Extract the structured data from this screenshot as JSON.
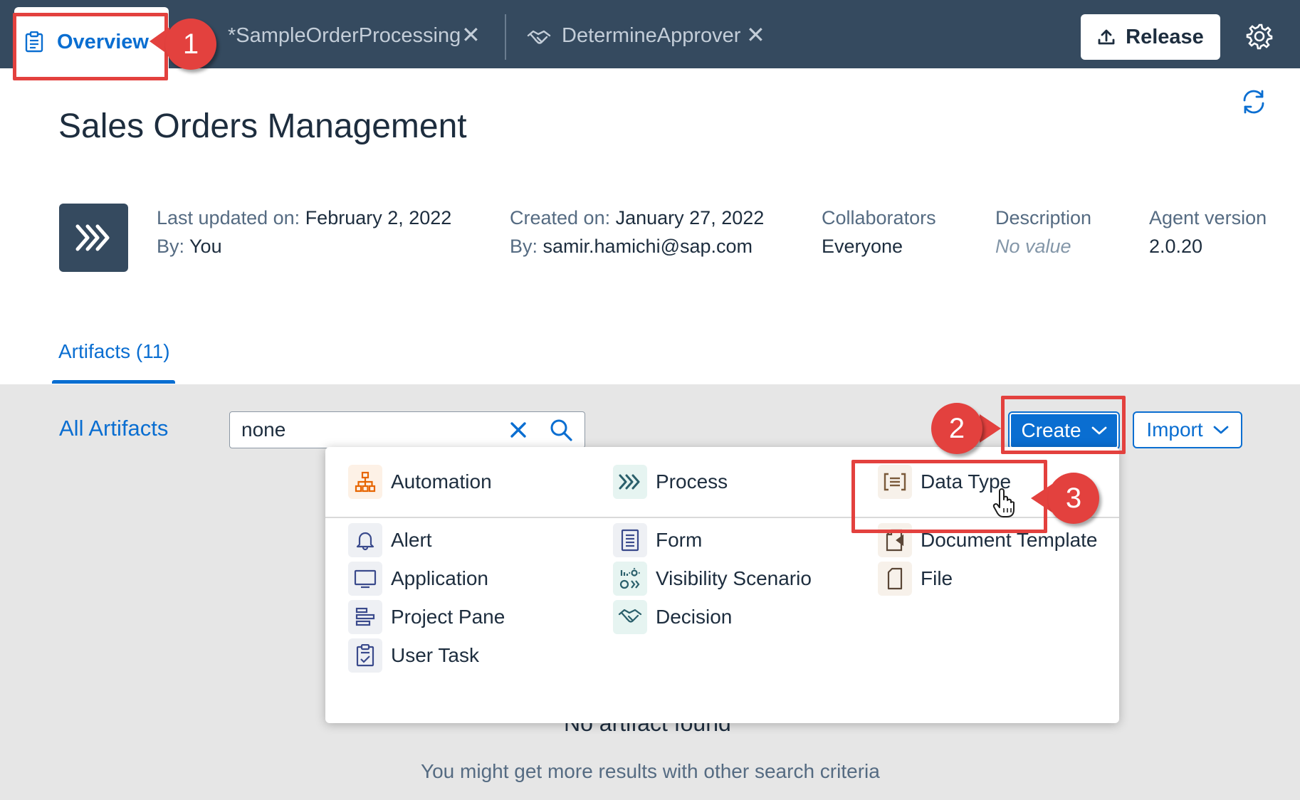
{
  "shell": {
    "tabs": [
      {
        "label": "Overview",
        "icon": "clipboard-icon"
      },
      {
        "label": "*SampleOrderProcessing",
        "icon": ""
      },
      {
        "label": "DetermineApprover",
        "icon": "handshake-icon"
      }
    ],
    "close_glyph": "✕",
    "release_label": "Release",
    "colors": {
      "shell_bg": "#354a5f",
      "accent": "#0a6ed1",
      "annotation": "#e3413e"
    }
  },
  "header": {
    "title": "Sales Orders Management",
    "last_updated_key": "Last updated on:",
    "last_updated_val": "February 2, 2022",
    "by_key": "By:",
    "by_you": "You",
    "created_key": "Created on:",
    "created_val": "January 27, 2022",
    "created_by": "samir.hamichi@sap.com",
    "collaborators_key": "Collaborators",
    "collaborators_val": "Everyone",
    "description_key": "Description",
    "description_val": "No value",
    "agent_key": "Agent version",
    "agent_val": "2.0.20"
  },
  "tabs": {
    "artifacts": "Artifacts (11)"
  },
  "toolbar": {
    "all_artifacts": "All Artifacts",
    "search_value": "none",
    "create_label": "Create",
    "import_label": "Import"
  },
  "empty_state": {
    "title": "No artifact found",
    "hint": "You might get more results with other search criteria"
  },
  "create_menu": {
    "automation": "Automation",
    "process": "Process",
    "data_type": "Data Type",
    "alert": "Alert",
    "form": "Form",
    "document_template": "Document Template",
    "application": "Application",
    "visibility_scenario": "Visibility Scenario",
    "file": "File",
    "project_pane": "Project Pane",
    "decision": "Decision",
    "user_task": "User Task"
  },
  "annotations": {
    "step1": "1",
    "step2": "2",
    "step3": "3"
  }
}
